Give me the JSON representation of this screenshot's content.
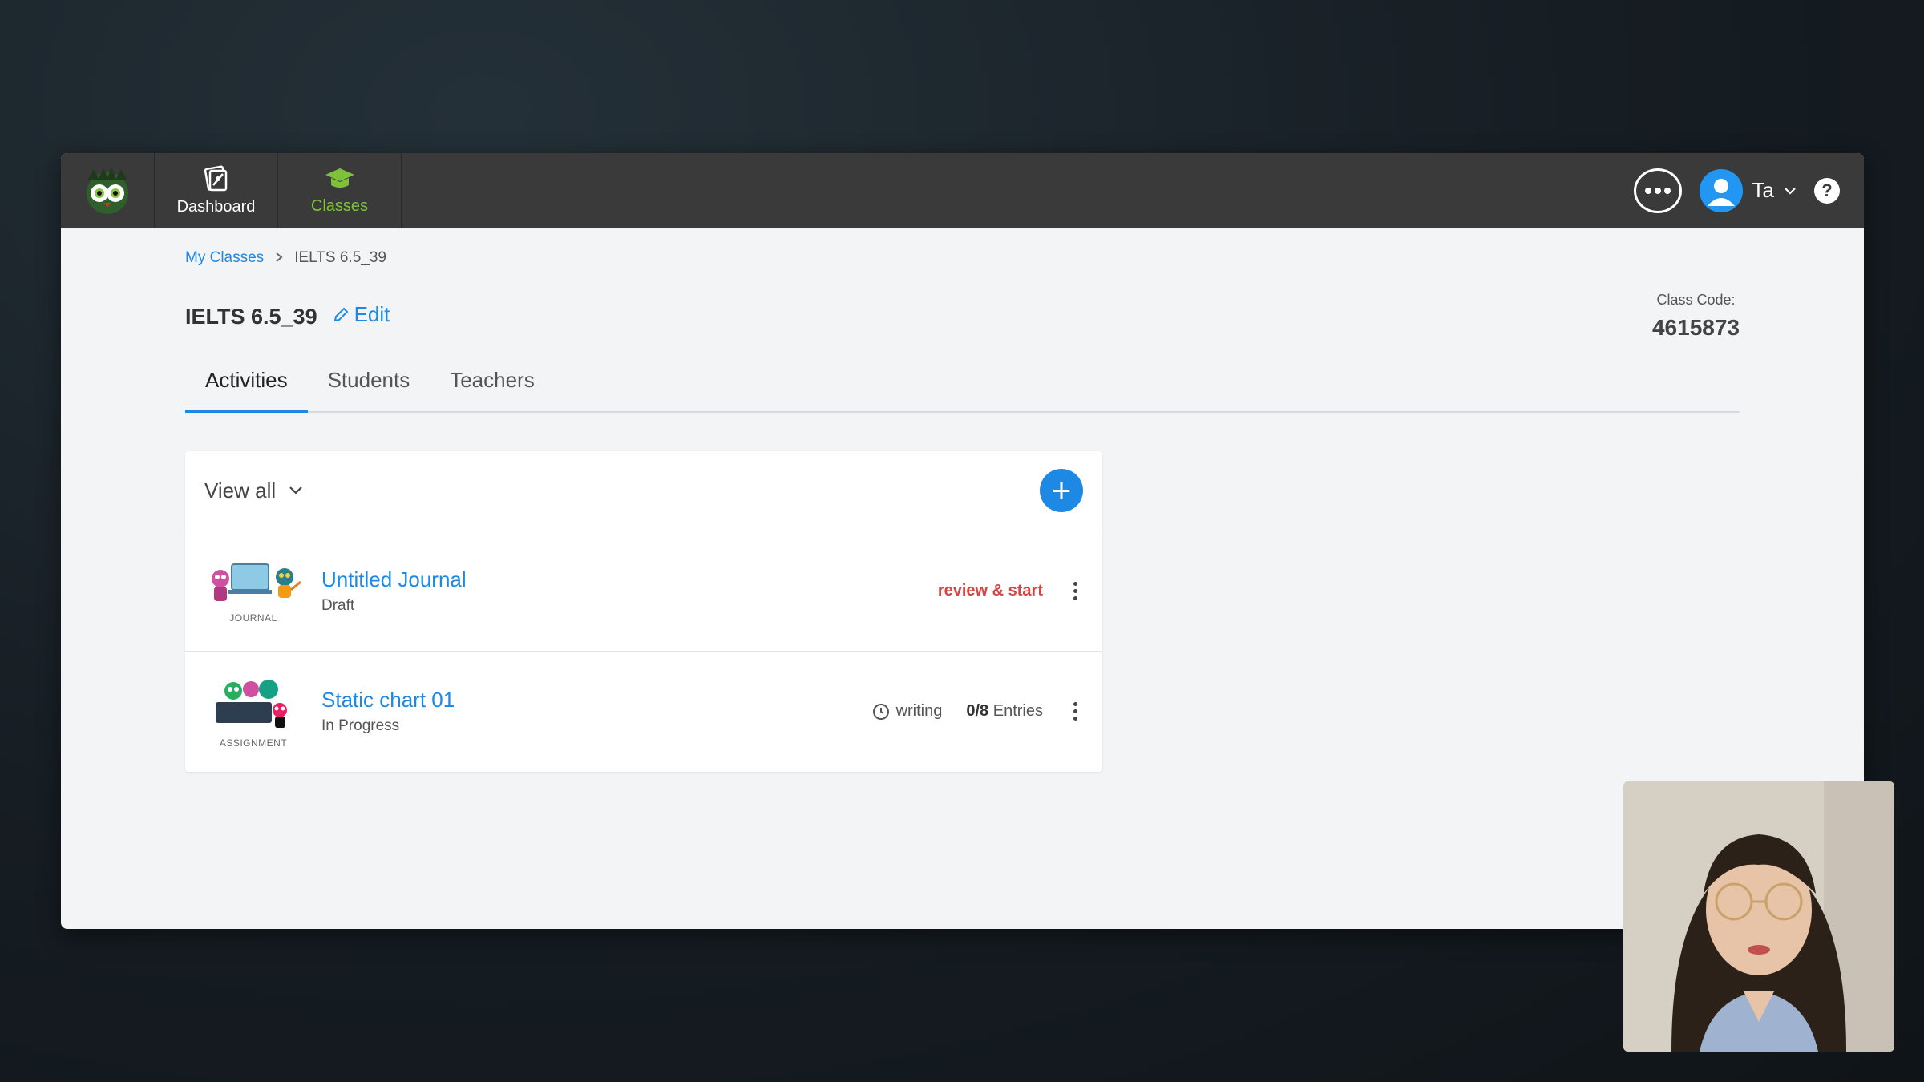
{
  "nav": {
    "logo": "owl-logo-icon",
    "items": [
      {
        "label": "Dashboard",
        "icon": "dashboard-icon",
        "active": false
      },
      {
        "label": "Classes",
        "icon": "graduation-cap-icon",
        "active": true
      }
    ]
  },
  "header_right": {
    "chat_icon": "chat-bubble-icon",
    "user_name": "Ta",
    "help_label": "?"
  },
  "breadcrumb": {
    "parent": "My Classes",
    "current": "IELTS 6.5_39"
  },
  "class": {
    "title": "IELTS 6.5_39",
    "edit_label": "Edit",
    "code_label": "Class Code:",
    "code_value": "4615873"
  },
  "tabs": [
    {
      "label": "Activities",
      "active": true
    },
    {
      "label": "Students",
      "active": false
    },
    {
      "label": "Teachers",
      "active": false
    }
  ],
  "panel": {
    "filter_label": "View all",
    "add_label": "+"
  },
  "activities": [
    {
      "kind": "JOURNAL",
      "title": "Untitled Journal",
      "status": "Draft",
      "action": "review & start"
    },
    {
      "kind": "ASSIGNMENT",
      "title": "Static chart 01",
      "status": "In Progress",
      "type_label": "writing",
      "entries_count": "0/8",
      "entries_label": "Entries"
    }
  ],
  "colors": {
    "accent": "#1e88e5",
    "nav_active": "#7ec23a",
    "review": "#d84343",
    "topbar": "#3a3a3a"
  }
}
